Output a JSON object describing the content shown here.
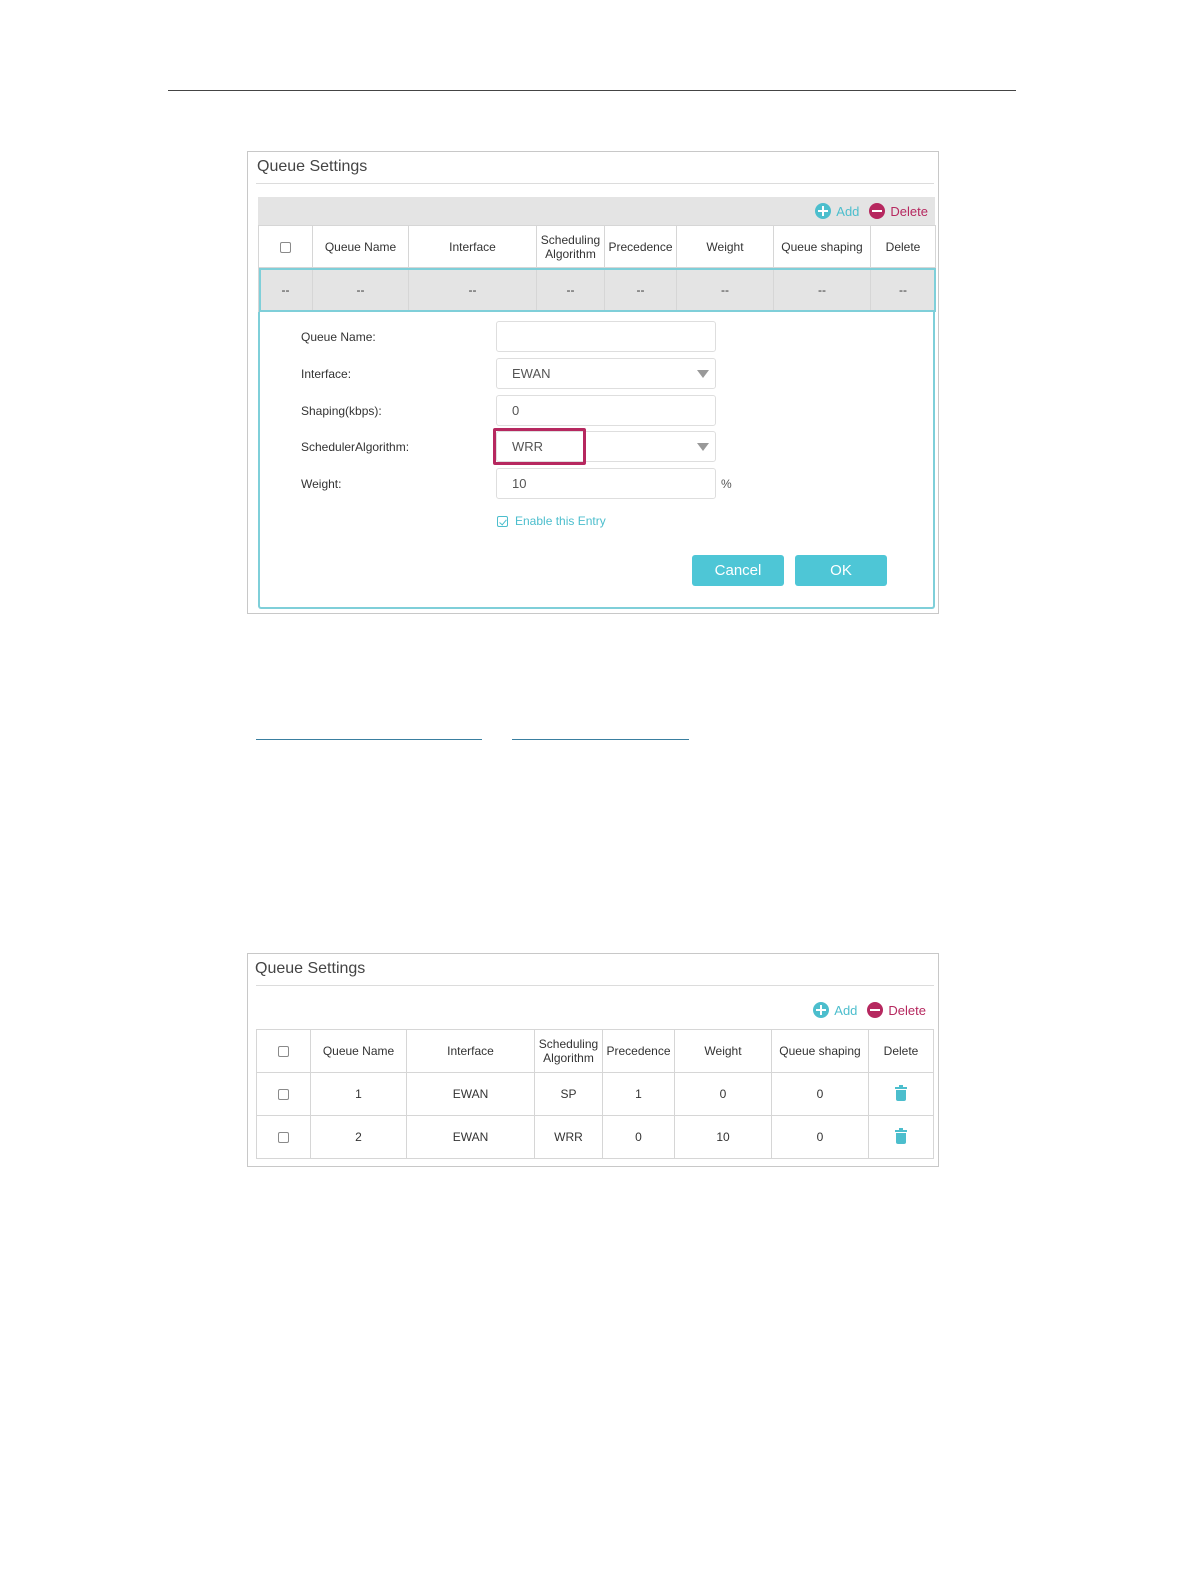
{
  "panel1": {
    "title": "Queue Settings",
    "toolbar": {
      "add_label": "Add",
      "delete_label": "Delete"
    },
    "columns": [
      "Queue Name",
      "Interface",
      "Scheduling Algorithm",
      "Precedence",
      "Weight",
      "Queue shaping",
      "Delete"
    ],
    "placeholder_row": [
      "--",
      "--",
      "--",
      "--",
      "--",
      "--",
      "--",
      "--"
    ],
    "form": {
      "queue_name_label": "Queue Name:",
      "queue_name_value": "",
      "interface_label": "Interface:",
      "interface_value": "EWAN",
      "shaping_label": "Shaping(kbps):",
      "shaping_value": "0",
      "scheduler_label": "SchedulerAlgorithm:",
      "scheduler_value": "WRR",
      "weight_label": "Weight:",
      "weight_value": "10",
      "weight_unit": "%",
      "enable_label": "Enable this Entry",
      "enable_checked": true,
      "cancel_label": "Cancel",
      "ok_label": "OK"
    }
  },
  "panel2": {
    "title": "Queue Settings",
    "toolbar": {
      "add_label": "Add",
      "delete_label": "Delete"
    },
    "columns": [
      "Queue Name",
      "Interface",
      "Scheduling Algorithm",
      "Precedence",
      "Weight",
      "Queue shaping",
      "Delete"
    ],
    "rows": [
      {
        "queue_name": "1",
        "interface": "EWAN",
        "algorithm": "SP",
        "precedence": "1",
        "weight": "0",
        "shaping": "0"
      },
      {
        "queue_name": "2",
        "interface": "EWAN",
        "algorithm": "WRR",
        "precedence": "0",
        "weight": "10",
        "shaping": "0"
      }
    ]
  },
  "colors": {
    "accent": "#4cbecd",
    "delete": "#b6285f",
    "highlight": "#b6285f"
  }
}
